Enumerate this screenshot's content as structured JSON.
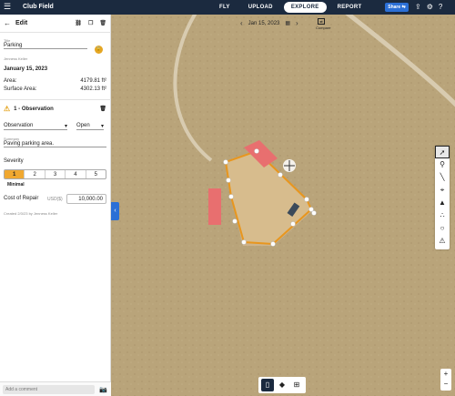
{
  "app": {
    "title": "Club Field",
    "menu_icon": "menu-icon"
  },
  "nav": {
    "tabs": [
      "FLY",
      "UPLOAD",
      "EXPLORE",
      "REPORT"
    ],
    "active": "EXPLORE"
  },
  "share": {
    "label": "Share"
  },
  "panel": {
    "header": "Edit",
    "title_label": "Title",
    "title_value": "Parking",
    "author": "Jenness Keller",
    "date": "January 15, 2023",
    "area_label": "Area:",
    "area_value": "4179.81 ft²",
    "surface_area_label": "Surface Area:",
    "surface_area_value": "4302.13 ft²",
    "observation": {
      "title": "1 - Observation",
      "type_value": "Observation",
      "status_value": "Open",
      "summary_label": "Summary",
      "summary_value": "Paving parking area.",
      "severity_label": "Severity",
      "severity_options": [
        "1",
        "2",
        "3",
        "4",
        "5"
      ],
      "severity_selected": "1",
      "severity_caption": "Minimal",
      "cost_label": "Cost of Repair",
      "cost_currency": "USD($)",
      "cost_value": "10,000.00",
      "created": "Created 2/3/23 by Jenness Keller"
    },
    "comment_placeholder": "Add a comment"
  },
  "map": {
    "date": "Jan 15, 2023",
    "compare_label": "Compare",
    "zoom_in": "+",
    "zoom_out": "−"
  },
  "colors": {
    "nav_bg": "#1b2a3f",
    "accent": "#2b6fd6",
    "severity_selected": "#f0a830",
    "polygon": "#e8961e",
    "warning": "#e5a623",
    "roof": "#e86f6f"
  }
}
